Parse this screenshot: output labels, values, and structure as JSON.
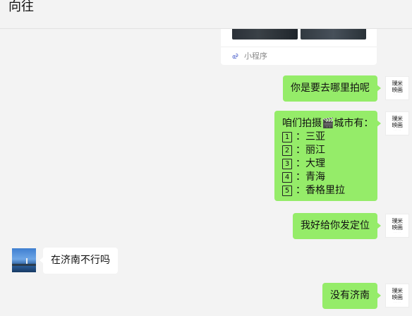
{
  "window": {
    "title": "向往"
  },
  "mini_program": {
    "label": "小程序",
    "icon": "mini-program-icon"
  },
  "brand_avatar": {
    "line1": "璞米",
    "line2": "映画"
  },
  "messages": [
    {
      "sender": "me",
      "text": "你是要去哪里拍呢"
    },
    {
      "sender": "me",
      "intro": "咱们拍摄🎬城市有：",
      "items": [
        {
          "num": "1",
          "text": "三亚"
        },
        {
          "num": "2",
          "text": "丽江"
        },
        {
          "num": "3",
          "text": "大理"
        },
        {
          "num": "4",
          "text": "青海"
        },
        {
          "num": "5",
          "text": "香格里拉"
        }
      ]
    },
    {
      "sender": "me",
      "text": "我好给你发定位"
    },
    {
      "sender": "other",
      "text": "在济南不行吗"
    },
    {
      "sender": "me",
      "text": "没有济南"
    }
  ],
  "colors": {
    "me_bubble": "#95ec69",
    "other_bubble": "#ffffff",
    "background": "#f3f3f3"
  }
}
